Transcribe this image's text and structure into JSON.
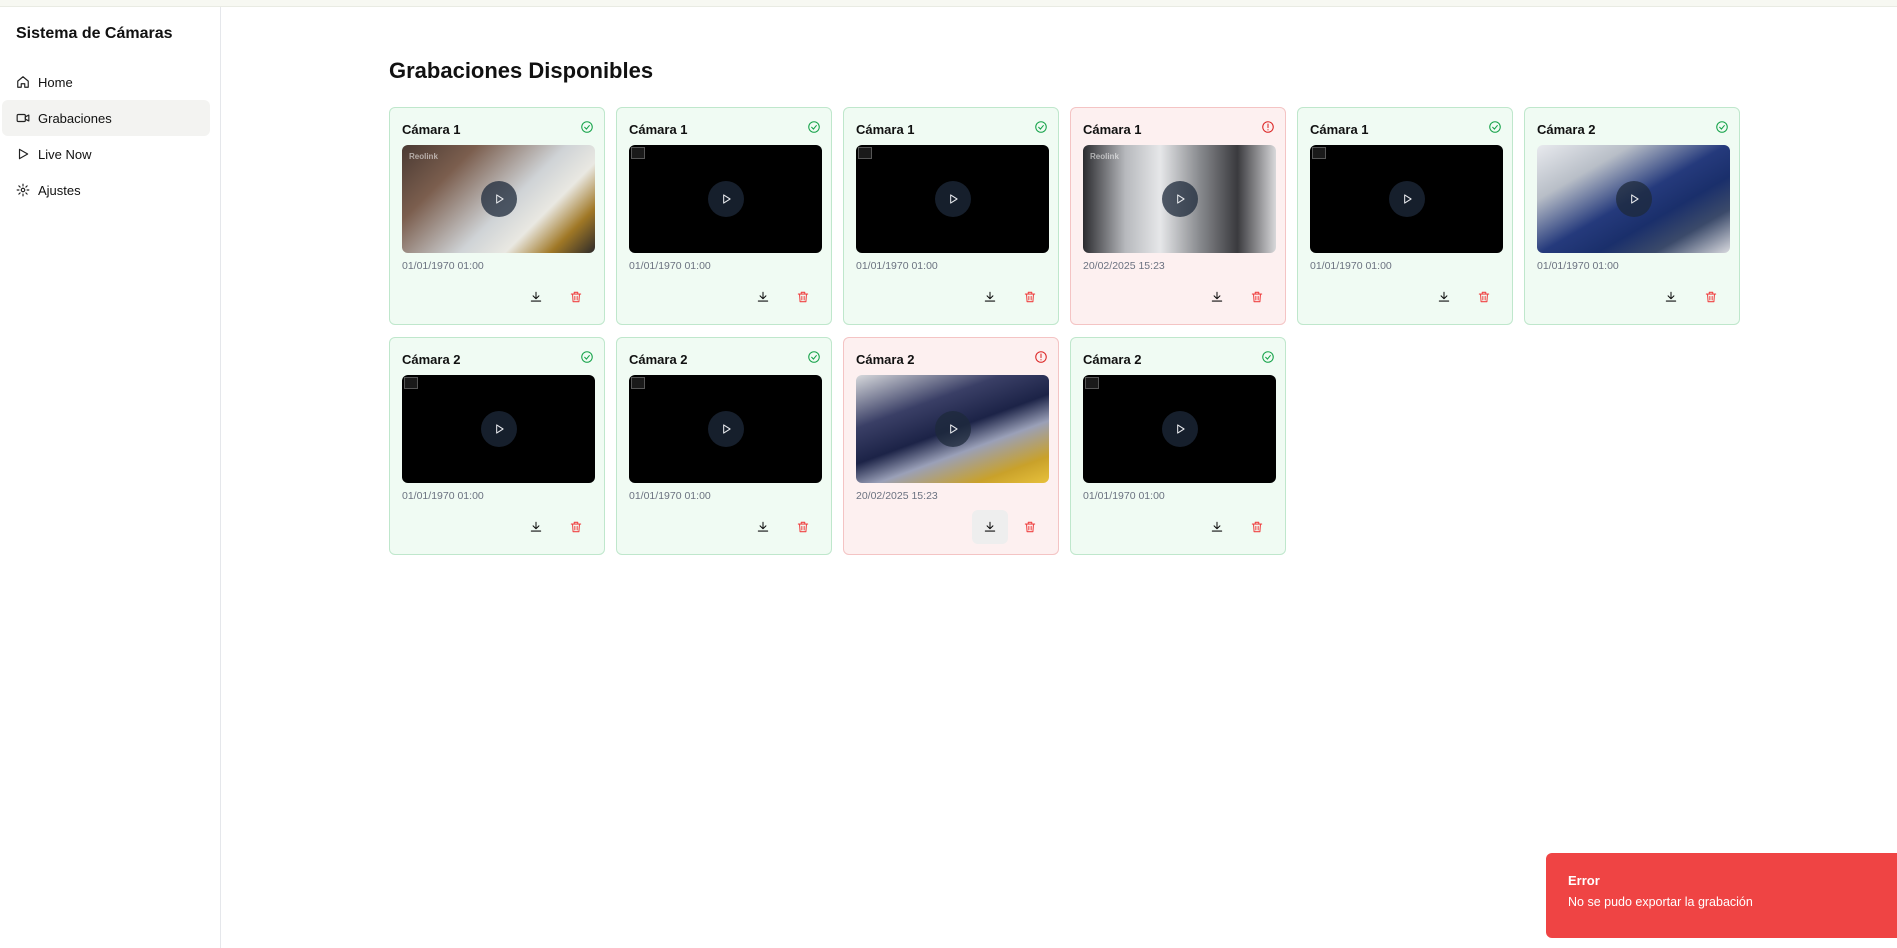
{
  "app": {
    "title": "Sistema de Cámaras"
  },
  "sidebar": {
    "items": [
      {
        "label": "Home",
        "icon": "home-icon",
        "active": false
      },
      {
        "label": "Grabaciones",
        "icon": "video-icon",
        "active": true
      },
      {
        "label": "Live Now",
        "icon": "play-icon",
        "active": false
      },
      {
        "label": "Ajustes",
        "icon": "gear-icon",
        "active": false
      }
    ]
  },
  "main": {
    "title": "Grabaciones Disponibles",
    "recordings": [
      {
        "camera": "Cámara 1",
        "status": "ok",
        "date": "01/01/1970 01:00",
        "thumb": "scene-a",
        "brand": "Reolink"
      },
      {
        "camera": "Cámara 1",
        "status": "ok",
        "date": "01/01/1970 01:00",
        "thumb": "broken",
        "brand": ""
      },
      {
        "camera": "Cámara 1",
        "status": "ok",
        "date": "01/01/1970 01:00",
        "thumb": "broken",
        "brand": ""
      },
      {
        "camera": "Cámara 1",
        "status": "error",
        "date": "20/02/2025 15:23",
        "thumb": "scene-b",
        "brand": "Reolink"
      },
      {
        "camera": "Cámara 1",
        "status": "ok",
        "date": "01/01/1970 01:00",
        "thumb": "broken",
        "brand": ""
      },
      {
        "camera": "Cámara 2",
        "status": "ok",
        "date": "01/01/1970 01:00",
        "thumb": "scene-c",
        "brand": ""
      },
      {
        "camera": "Cámara 2",
        "status": "ok",
        "date": "01/01/1970 01:00",
        "thumb": "broken",
        "brand": ""
      },
      {
        "camera": "Cámara 2",
        "status": "ok",
        "date": "01/01/1970 01:00",
        "thumb": "broken",
        "brand": ""
      },
      {
        "camera": "Cámara 2",
        "status": "error",
        "date": "20/02/2025 15:23",
        "thumb": "scene-d",
        "brand": ""
      },
      {
        "camera": "Cámara 2",
        "status": "ok",
        "date": "01/01/1970 01:00",
        "thumb": "broken",
        "brand": ""
      }
    ]
  },
  "toast": {
    "title": "Error",
    "message": "No se pudo exportar la grabación"
  },
  "colors": {
    "ok": "#16a34a",
    "error": "#dc2626",
    "toast_bg": "#ef4444"
  }
}
